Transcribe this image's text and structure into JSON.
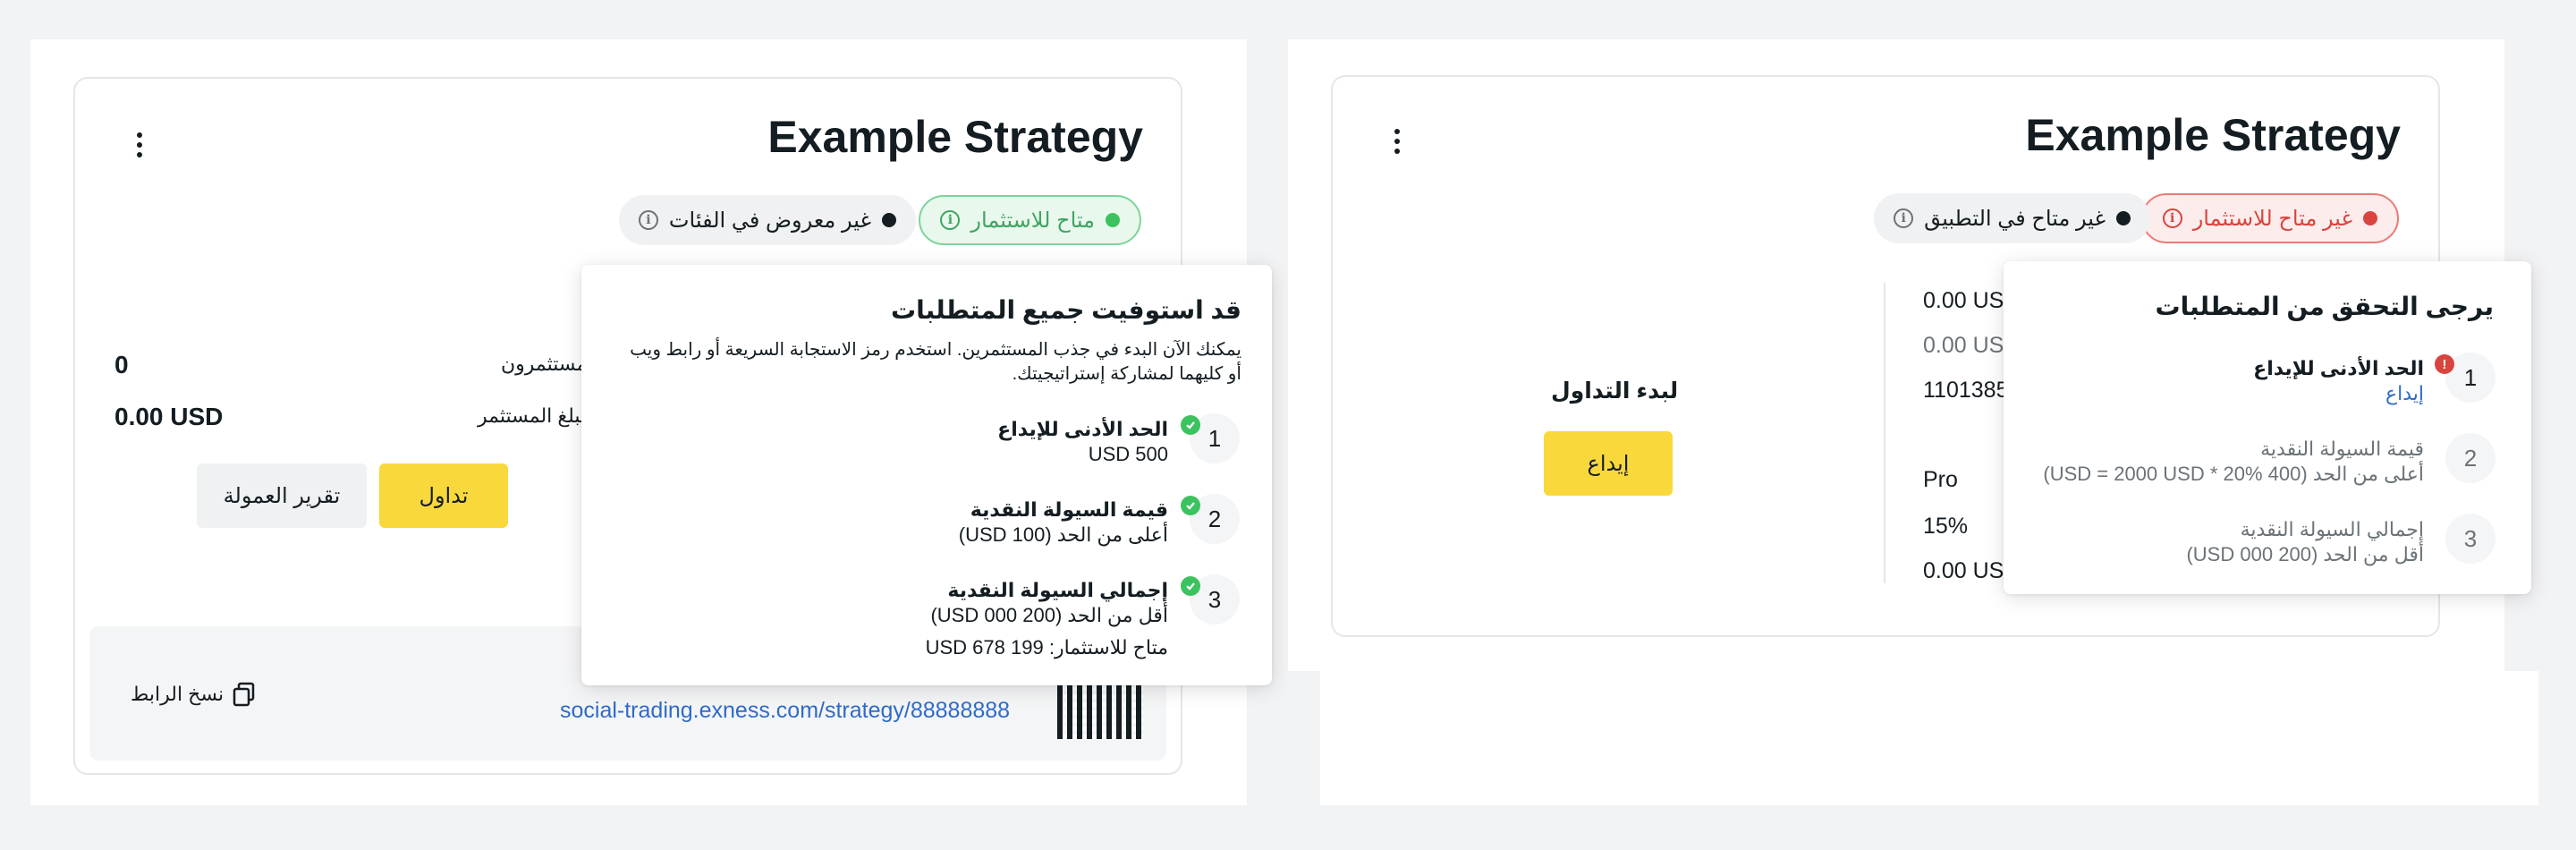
{
  "left": {
    "title": "Example Strategy",
    "badges": {
      "available": "متاح للاستثمار",
      "not_listed": "غير معروض في الفئات"
    },
    "popover": {
      "title": "قد استوفيت جميع المتطلبات",
      "description": "يمكنك الآن البدء في جذب المستثمرين. استخدم رمز الاستجابة السريعة أو رابط ويب أو كليهما لمشاركة إستراتيجيتك.",
      "steps": [
        {
          "num": "1",
          "title": "الحد الأدنى للإيداع",
          "sub": "500 USD"
        },
        {
          "num": "2",
          "title": "قيمة السيولة النقدية",
          "sub": "أعلى من الحد (100 USD)"
        },
        {
          "num": "3",
          "title": "إجمالي السيولة النقدية",
          "sub": "أقل من الحد (200 000 USD)",
          "sub2": "متاح للاستثمار: 199 678 USD"
        }
      ]
    },
    "stats": [
      {
        "label": "المستثمرون",
        "value": "0"
      },
      {
        "label": "المبلغ المستثمر",
        "value": "0.00 USD"
      }
    ],
    "buttons": {
      "trade": "تداول",
      "commission_report": "تقرير العمولة"
    },
    "footer": {
      "copy_link": "نسخ الرابط",
      "url": "social-trading.exness.com/strategy/88888888"
    }
  },
  "right": {
    "title": "Example Strategy",
    "badges": {
      "not_available": "غير متاح للاستثمار",
      "not_in_app": "غير متاح في التطبيق"
    },
    "popover": {
      "title": "يرجى التحقق من المتطلبات",
      "steps": [
        {
          "num": "1",
          "title": "الحد الأدنى للإيداع",
          "link": "إيداع"
        },
        {
          "num": "2",
          "title": "قيمة السيولة النقدية",
          "sub": "أعلى من الحد (400 USD = 2000 USD * 20%)"
        },
        {
          "num": "3",
          "title": "إجمالي السيولة النقدية",
          "sub": "أقل من الحد (200 000 USD)"
        }
      ]
    },
    "start_trading": "لبدء التداول",
    "deposit_button": "إيداع",
    "values": [
      "0.00 USD",
      "0.00 USD",
      "1101385",
      "Pro",
      "15%",
      "0.00 USD"
    ]
  },
  "colors": {
    "accent_yellow": "#f9d83b",
    "success_green": "#3cc35f",
    "error_red": "#d9443f",
    "link_blue": "#2f6bc9"
  }
}
